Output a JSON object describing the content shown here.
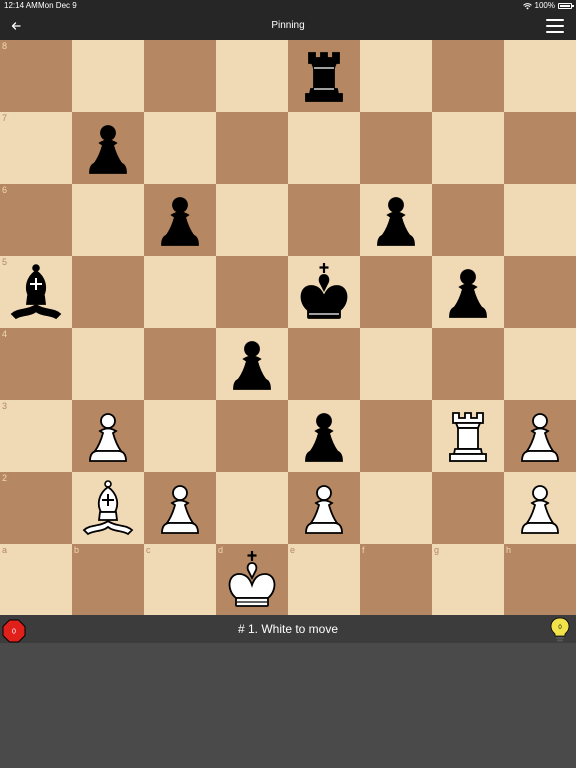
{
  "status_bar": {
    "time": "12:14 AM",
    "date": "Mon Dec 9",
    "battery": "100%"
  },
  "nav": {
    "title": "Pinning",
    "back_icon": "arrow-left-icon",
    "menu_icon": "hamburger-menu-icon"
  },
  "board": {
    "light_square_color": "#f0d9b5",
    "dark_square_color": "#b58863",
    "rank_labels": [
      "8",
      "7",
      "6",
      "5",
      "4",
      "3",
      "2"
    ],
    "file_labels": [
      "a",
      "b",
      "c",
      "d",
      "e",
      "f",
      "g",
      "h"
    ],
    "pieces": [
      {
        "square": "e8",
        "color": "black",
        "type": "rook"
      },
      {
        "square": "b7",
        "color": "black",
        "type": "pawn"
      },
      {
        "square": "c6",
        "color": "black",
        "type": "pawn"
      },
      {
        "square": "f6",
        "color": "black",
        "type": "pawn"
      },
      {
        "square": "a5",
        "color": "black",
        "type": "bishop"
      },
      {
        "square": "e5",
        "color": "black",
        "type": "king"
      },
      {
        "square": "g5",
        "color": "black",
        "type": "pawn"
      },
      {
        "square": "d4",
        "color": "black",
        "type": "pawn"
      },
      {
        "square": "b3",
        "color": "white",
        "type": "pawn"
      },
      {
        "square": "e3",
        "color": "black",
        "type": "pawn"
      },
      {
        "square": "g3",
        "color": "white",
        "type": "rook"
      },
      {
        "square": "h3",
        "color": "white",
        "type": "pawn"
      },
      {
        "square": "b2",
        "color": "white",
        "type": "bishop"
      },
      {
        "square": "c2",
        "color": "white",
        "type": "pawn"
      },
      {
        "square": "e2",
        "color": "white",
        "type": "pawn"
      },
      {
        "square": "h2",
        "color": "white",
        "type": "pawn"
      },
      {
        "square": "d1",
        "color": "white",
        "type": "king"
      }
    ]
  },
  "footer": {
    "puzzle_label": "# 1. White to move",
    "mistakes_count": "0",
    "mistakes_color": "#e0201b",
    "hints_count": "0",
    "hints_color": "#f2e34a"
  }
}
